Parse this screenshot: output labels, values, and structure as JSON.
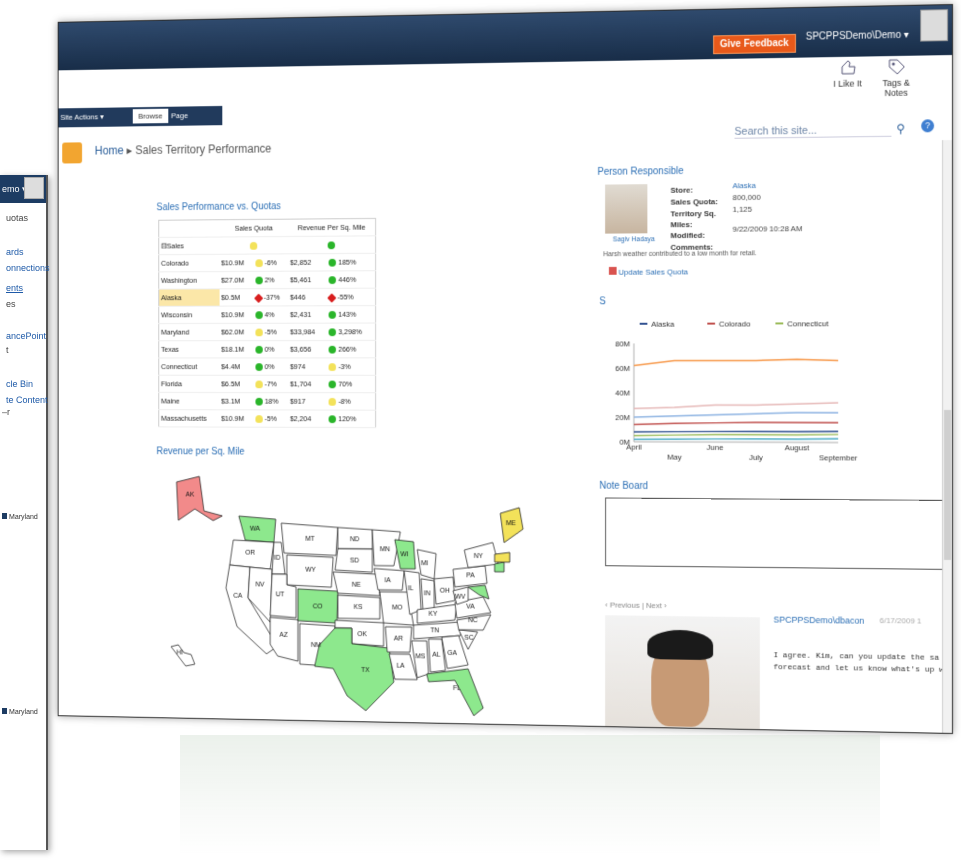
{
  "topbar": {
    "feedback": "Give Feedback",
    "user": "SPCPPSDemo\\Demo ▾"
  },
  "tabs": {
    "site_actions": "Site Actions ▾",
    "browse": "Browse",
    "page": "Page"
  },
  "ribbon": {
    "like": "I Like It",
    "tags": "Tags &",
    "notes": "Notes"
  },
  "breadcrumb": {
    "home": "Home",
    "sep": "▸",
    "current": "Sales Territory Performance"
  },
  "search": {
    "placeholder": "Search this site..."
  },
  "back_window": {
    "user": "emo ▾",
    "items": [
      "uotas",
      "ards",
      "onnections",
      "ents",
      "es",
      "ancePoint",
      "t",
      "cle Bin",
      "te Content",
      "–r"
    ],
    "legend": [
      "Maryland",
      "Maryland"
    ]
  },
  "kpi": {
    "title": "Sales Performance vs. Quotas",
    "col1": "Sales Quota",
    "col2": "Revenue Per Sq. Mile",
    "group": "Sales",
    "rows": [
      {
        "name": "Colorado",
        "v1": "$10.9M",
        "p1": "-6%",
        "s1": "y",
        "v2": "$2,852",
        "p2": "185%",
        "s2": "g"
      },
      {
        "name": "Washington",
        "v1": "$27.0M",
        "p1": "2%",
        "s1": "g",
        "v2": "$5,461",
        "p2": "446%",
        "s2": "g"
      },
      {
        "name": "Alaska",
        "v1": "$0.5M",
        "p1": "-37%",
        "s1": "r",
        "v2": "$446",
        "p2": "-55%",
        "s2": "r"
      },
      {
        "name": "Wisconsin",
        "v1": "$10.9M",
        "p1": "4%",
        "s1": "g",
        "v2": "$2,431",
        "p2": "143%",
        "s2": "g"
      },
      {
        "name": "Maryland",
        "v1": "$62.0M",
        "p1": "-5%",
        "s1": "y",
        "v2": "$33,984",
        "p2": "3,298%",
        "s2": "g"
      },
      {
        "name": "Texas",
        "v1": "$18.1M",
        "p1": "0%",
        "s1": "g",
        "v2": "$3,656",
        "p2": "266%",
        "s2": "g"
      },
      {
        "name": "Connecticut",
        "v1": "$4.4M",
        "p1": "0%",
        "s1": "g",
        "v2": "$974",
        "p2": "-3%",
        "s2": "y"
      },
      {
        "name": "Florida",
        "v1": "$6.5M",
        "p1": "-7%",
        "s1": "y",
        "v2": "$1,704",
        "p2": "70%",
        "s2": "g"
      },
      {
        "name": "Maine",
        "v1": "$3.1M",
        "p1": "18%",
        "s1": "g",
        "v2": "$917",
        "p2": "-8%",
        "s2": "y"
      },
      {
        "name": "Massachusetts",
        "v1": "$10.9M",
        "p1": "-5%",
        "s1": "y",
        "v2": "$2,204",
        "p2": "120%",
        "s2": "g"
      }
    ]
  },
  "map": {
    "title": "Revenue per Sq. Mile",
    "labels": [
      "AK",
      "WA",
      "OR",
      "CA",
      "NV",
      "ID",
      "MT",
      "WY",
      "UT",
      "AZ",
      "CO",
      "NM",
      "ND",
      "SD",
      "NE",
      "KS",
      "OK",
      "TX",
      "MN",
      "IA",
      "MO",
      "AR",
      "LA",
      "WI",
      "IL",
      "MI",
      "IN",
      "OH",
      "KY",
      "TN",
      "MS",
      "AL",
      "GA",
      "FL",
      "SC",
      "NC",
      "VA",
      "WV",
      "PA",
      "NY",
      "ME",
      "HI"
    ]
  },
  "person": {
    "title": "Person Responsible",
    "name": "Sagiv Hadaya",
    "store_label": "Store:",
    "store": "Alaska",
    "quota_label": "Sales Quota:",
    "quota": "800,000",
    "terr_label": "Territory Sq.",
    "terr": "1,125",
    "miles_label": "Miles:",
    "mod_label": "Modified:",
    "mod": "9/22/2009 10:28 AM",
    "comments_label": "Comments:",
    "note": "Harsh weather contributed to a low month for retail.",
    "update": "Update Sales Quota"
  },
  "chart_data": {
    "type": "line",
    "title": "S",
    "categories": [
      "April",
      "May",
      "June",
      "July",
      "August",
      "September"
    ],
    "ylim": [
      0,
      80
    ],
    "ytick_labels": [
      "0M",
      "20M",
      "40M",
      "60M",
      "80M"
    ],
    "series": [
      {
        "name": "Alaska",
        "color": "#2e4f8f",
        "values": [
          8,
          8.3,
          8.5,
          8.6,
          8.7,
          9
        ]
      },
      {
        "name": "Colorado",
        "color": "#c0504d",
        "values": [
          14,
          15,
          15.5,
          16,
          16,
          16
        ]
      },
      {
        "name": "Connecticut",
        "color": "#9bbb59",
        "values": [
          5,
          5.5,
          6,
          6,
          6,
          6.5
        ]
      },
      {
        "color": "#f79646",
        "values": [
          62,
          66,
          66,
          66,
          67,
          66
        ]
      },
      {
        "color": "#e6b9b8",
        "values": [
          27,
          28,
          30,
          30,
          31,
          32
        ]
      },
      {
        "color": "#8db3e2",
        "values": [
          20,
          21,
          22,
          23,
          24,
          24
        ]
      },
      {
        "color": "#4bacc6",
        "values": [
          2,
          2.2,
          2.5,
          2.6,
          2.7,
          3
        ]
      }
    ]
  },
  "note_board": {
    "title": "Note Board",
    "prev": "‹ Previous",
    "sep": "|",
    "next": "Next ›"
  },
  "post": {
    "author": "SPCPPSDemo\\dbacon",
    "date": "6/17/2009 1",
    "body": "I agree. Kim, can you update the sa forecast and let us know what's up w"
  }
}
